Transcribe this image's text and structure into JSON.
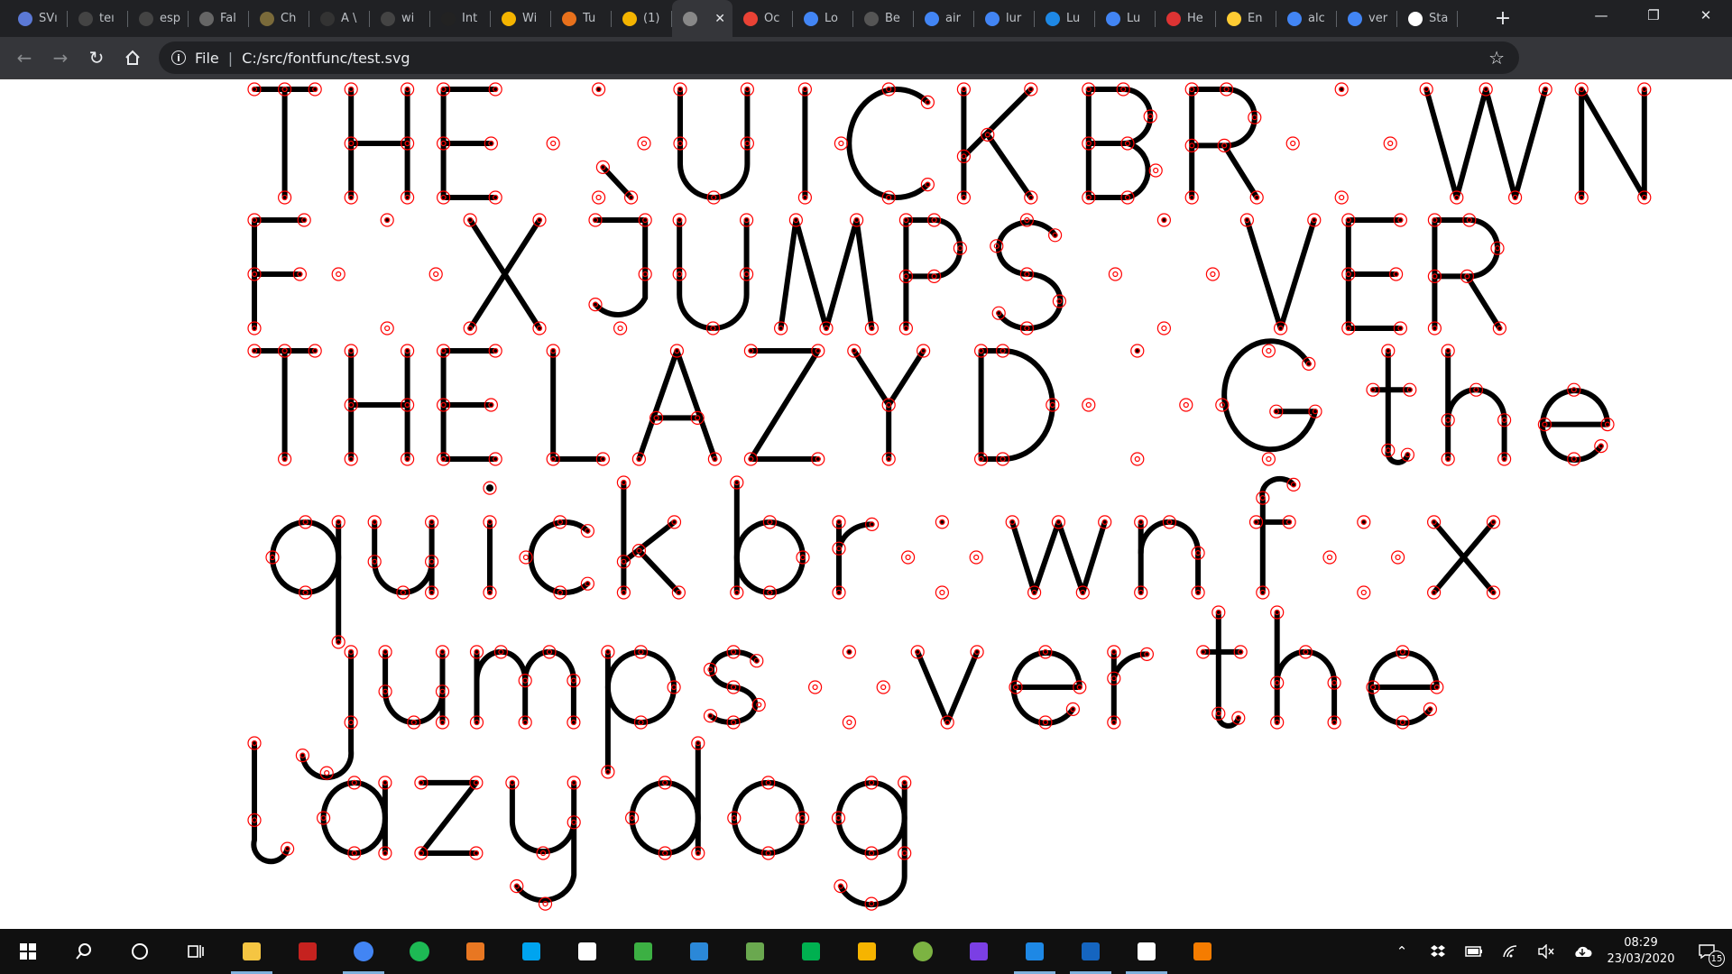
{
  "colors": {
    "titlebar": "#202124",
    "toolbar": "#35363a",
    "glyph_stroke": "#000000",
    "node_marker": "#ff0000",
    "taskbar": "#101010"
  },
  "tabs": [
    {
      "label": "SVı",
      "favicon": "visual-studio-icon",
      "color": "#5b79d6"
    },
    {
      "label": "teı",
      "favicon": "github-icon",
      "color": "#444"
    },
    {
      "label": "esp",
      "favicon": "github-icon",
      "color": "#444"
    },
    {
      "label": "Fal",
      "favicon": "globe-icon",
      "color": "#666"
    },
    {
      "label": "Ch",
      "favicon": "image-icon",
      "color": "#7a6a3a"
    },
    {
      "label": "A \\",
      "favicon": "web-icon",
      "color": "#333"
    },
    {
      "label": "wi",
      "favicon": "github-icon",
      "color": "#444"
    },
    {
      "label": "Int",
      "favicon": "graduation-cap-icon",
      "color": "#222"
    },
    {
      "label": "Wi",
      "favicon": "g-icon",
      "color": "#f4b400"
    },
    {
      "label": "Tu",
      "favicon": "fan-icon",
      "color": "#e8711c"
    },
    {
      "label": "(1)",
      "favicon": "g-icon",
      "color": "#f4b400"
    },
    {
      "label": "",
      "favicon": "globe-icon",
      "color": "#888",
      "active": true
    },
    {
      "label": "Oc",
      "favicon": "pinwheel-icon",
      "color": "#e94235"
    },
    {
      "label": "Lo",
      "favicon": "shield-icon",
      "color": "#4285f4"
    },
    {
      "label": "Be",
      "favicon": "h-icon",
      "color": "#555"
    },
    {
      "label": "air",
      "favicon": "google-icon",
      "color": "#4285f4"
    },
    {
      "label": "lur",
      "favicon": "google-icon",
      "color": "#4285f4"
    },
    {
      "label": "Lu",
      "favicon": "l-icon",
      "color": "#1e88e5"
    },
    {
      "label": "Lu",
      "favicon": "google-icon",
      "color": "#4285f4"
    },
    {
      "label": "He",
      "favicon": "lips-icon",
      "color": "#d33"
    },
    {
      "label": "En",
      "favicon": "book-icon",
      "color": "#ffcc33"
    },
    {
      "label": "alc",
      "favicon": "google-icon",
      "color": "#4285f4"
    },
    {
      "label": "ver",
      "favicon": "google-icon",
      "color": "#4285f4"
    },
    {
      "label": "Sta",
      "favicon": "wikipedia-icon",
      "color": "#ffffff"
    }
  ],
  "address": {
    "scheme": "File",
    "path": "C:/src/fontfunc/test.svg"
  },
  "svg_text": {
    "lines": [
      "THE QU ICK BROWN",
      "FOX JUMPS OVER",
      "THE LAZY DOG the",
      "qu ick brown fox",
      "jumps over the",
      "lazy dog"
    ]
  },
  "clock": {
    "time": "08:29",
    "date": "23/03/2020"
  },
  "notifications": {
    "count": "15"
  },
  "taskbar_apps": [
    "file-explorer-icon",
    "gmail-icon",
    "chrome-icon",
    "spotify-icon",
    "fontforge-icon",
    "c-app-icon",
    "document-icon",
    "crossover-icon",
    "terminal-icon",
    "photo-editor-icon",
    "link-app-icon",
    "lightbulb-icon",
    "globe-app-icon",
    "visual-studio-icon",
    "vscode-icon",
    "devops-icon",
    "photos-icon",
    "blender-icon"
  ]
}
